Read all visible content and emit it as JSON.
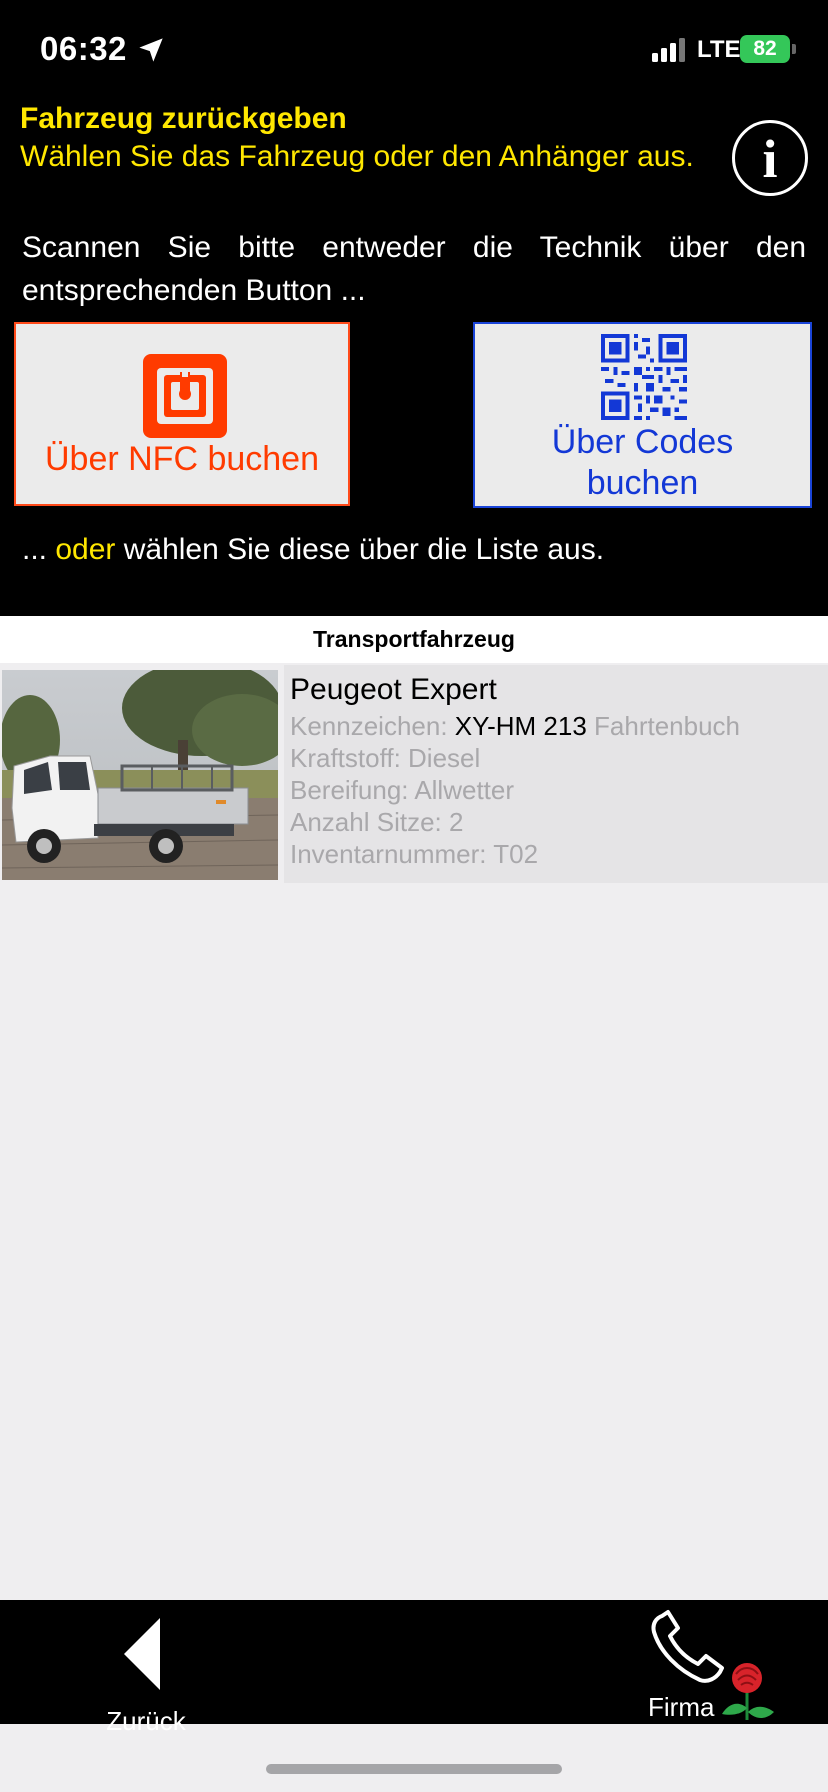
{
  "status_bar": {
    "time": "06:32",
    "network": "LTE",
    "battery": "82"
  },
  "header": {
    "title": "Fahrzeug zurückgeben",
    "subtitle": "Wählen Sie das Fahrzeug oder den Anhänger aus.",
    "info_glyph": "i"
  },
  "instruction": "Scannen Sie bitte entweder die Technik über den entsprechenden Button ...",
  "buttons": {
    "nfc_label": "Über NFC buchen",
    "codes_label_line1": "Über Codes",
    "codes_label_line2": "buchen"
  },
  "list_hint": {
    "prefix": "... ",
    "highlight": "oder",
    "suffix": " wählen Sie diese über die Liste aus."
  },
  "section": {
    "title": "Transportfahrzeug"
  },
  "vehicle": {
    "name": "Peugeot Expert",
    "plate_label": "Kennzeichen:",
    "plate_value": "XY-HM 213",
    "logbook": "Fahrtenbuch",
    "fuel": "Kraftstoff: Diesel",
    "tires": "Bereifung: Allwetter",
    "seats": "Anzahl Sitze: 2",
    "inventory": "Inventarnummer: T02"
  },
  "bottom_nav": {
    "back_label": "Zurück",
    "company_label": "Firma"
  },
  "colors": {
    "accent_yellow": "#ffe700",
    "nfc_orange": "#ff3b00",
    "codes_blue": "#1338d6",
    "battery_green": "#34c759"
  }
}
